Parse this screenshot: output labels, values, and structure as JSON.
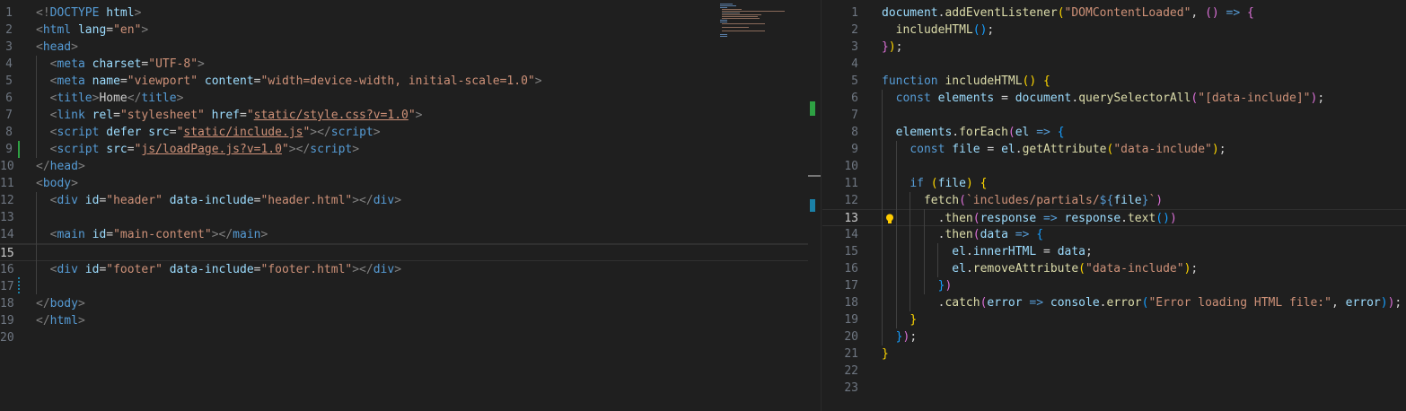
{
  "left_editor": {
    "lines": [
      {
        "n": "1",
        "tokens": [
          [
            "br",
            "<!"
          ],
          [
            "tag",
            "DOCTYPE"
          ],
          [
            "attr",
            " html"
          ],
          [
            "br",
            ">"
          ]
        ]
      },
      {
        "n": "2",
        "tokens": [
          [
            "br",
            "<"
          ],
          [
            "tag",
            "html"
          ],
          [
            "attr",
            " lang"
          ],
          [
            "txtc",
            "="
          ],
          [
            "str",
            "\"en\""
          ],
          [
            "br",
            ">"
          ]
        ]
      },
      {
        "n": "3",
        "tokens": [
          [
            "br",
            "<"
          ],
          [
            "tag",
            "head"
          ],
          [
            "br",
            ">"
          ]
        ]
      },
      {
        "n": "4",
        "tokens": [
          [
            "txtc",
            "  "
          ],
          [
            "br",
            "<"
          ],
          [
            "tag",
            "meta"
          ],
          [
            "attr",
            " charset"
          ],
          [
            "txtc",
            "="
          ],
          [
            "str",
            "\"UTF-8\""
          ],
          [
            "br",
            ">"
          ]
        ]
      },
      {
        "n": "5",
        "tokens": [
          [
            "txtc",
            "  "
          ],
          [
            "br",
            "<"
          ],
          [
            "tag",
            "meta"
          ],
          [
            "attr",
            " name"
          ],
          [
            "txtc",
            "="
          ],
          [
            "str",
            "\"viewport\""
          ],
          [
            "attr",
            " content"
          ],
          [
            "txtc",
            "="
          ],
          [
            "str",
            "\"width=device-width, initial-scale=1.0\""
          ],
          [
            "br",
            ">"
          ]
        ]
      },
      {
        "n": "6",
        "tokens": [
          [
            "txtc",
            "  "
          ],
          [
            "br",
            "<"
          ],
          [
            "tag",
            "title"
          ],
          [
            "br",
            ">"
          ],
          [
            "txtc",
            "Home"
          ],
          [
            "br",
            "</"
          ],
          [
            "tag",
            "title"
          ],
          [
            "br",
            ">"
          ]
        ]
      },
      {
        "n": "7",
        "tokens": [
          [
            "txtc",
            "  "
          ],
          [
            "br",
            "<"
          ],
          [
            "tag",
            "link"
          ],
          [
            "attr",
            " rel"
          ],
          [
            "txtc",
            "="
          ],
          [
            "str",
            "\"stylesheet\""
          ],
          [
            "attr",
            " href"
          ],
          [
            "txtc",
            "="
          ],
          [
            "str",
            "\""
          ],
          [
            "link",
            "static/style.css?v=1.0"
          ],
          [
            "str",
            "\""
          ],
          [
            "br",
            ">"
          ]
        ]
      },
      {
        "n": "8",
        "tokens": [
          [
            "txtc",
            "  "
          ],
          [
            "br",
            "<"
          ],
          [
            "tag",
            "script"
          ],
          [
            "attr",
            " defer src"
          ],
          [
            "txtc",
            "="
          ],
          [
            "str",
            "\""
          ],
          [
            "link",
            "static/include.js"
          ],
          [
            "str",
            "\""
          ],
          [
            "br",
            "></"
          ],
          [
            "tag",
            "script"
          ],
          [
            "br",
            ">"
          ]
        ]
      },
      {
        "n": "9",
        "tokens": [
          [
            "txtc",
            "  "
          ],
          [
            "br",
            "<"
          ],
          [
            "tag",
            "script"
          ],
          [
            "attr",
            " src"
          ],
          [
            "txtc",
            "="
          ],
          [
            "str",
            "\""
          ],
          [
            "link",
            "js/loadPage.js?v=1.0"
          ],
          [
            "str",
            "\""
          ],
          [
            "br",
            "></"
          ],
          [
            "tag",
            "script"
          ],
          [
            "br",
            ">"
          ]
        ]
      },
      {
        "n": "10",
        "tokens": [
          [
            "br",
            "</"
          ],
          [
            "tag",
            "head"
          ],
          [
            "br",
            ">"
          ]
        ]
      },
      {
        "n": "11",
        "tokens": [
          [
            "br",
            "<"
          ],
          [
            "tag",
            "body"
          ],
          [
            "br",
            ">"
          ]
        ]
      },
      {
        "n": "12",
        "tokens": [
          [
            "txtc",
            "  "
          ],
          [
            "br",
            "<"
          ],
          [
            "tag",
            "div"
          ],
          [
            "attr",
            " id"
          ],
          [
            "txtc",
            "="
          ],
          [
            "str",
            "\"header\""
          ],
          [
            "attr",
            " data-include"
          ],
          [
            "txtc",
            "="
          ],
          [
            "str",
            "\"header.html\""
          ],
          [
            "br",
            "></"
          ],
          [
            "tag",
            "div"
          ],
          [
            "br",
            ">"
          ]
        ]
      },
      {
        "n": "13",
        "tokens": []
      },
      {
        "n": "14",
        "tokens": [
          [
            "txtc",
            "  "
          ],
          [
            "br",
            "<"
          ],
          [
            "tag",
            "main"
          ],
          [
            "attr",
            " id"
          ],
          [
            "txtc",
            "="
          ],
          [
            "str",
            "\"main-content\""
          ],
          [
            "br",
            "></"
          ],
          [
            "tag",
            "main"
          ],
          [
            "br",
            ">"
          ]
        ]
      },
      {
        "n": "15",
        "tokens": []
      },
      {
        "n": "16",
        "tokens": [
          [
            "txtc",
            "  "
          ],
          [
            "br",
            "<"
          ],
          [
            "tag",
            "div"
          ],
          [
            "attr",
            " id"
          ],
          [
            "txtc",
            "="
          ],
          [
            "str",
            "\"footer\""
          ],
          [
            "attr",
            " data-include"
          ],
          [
            "txtc",
            "="
          ],
          [
            "str",
            "\"footer.html\""
          ],
          [
            "br",
            "></"
          ],
          [
            "tag",
            "div"
          ],
          [
            "br",
            ">"
          ]
        ]
      },
      {
        "n": "17",
        "tokens": []
      },
      {
        "n": "18",
        "tokens": [
          [
            "br",
            "</"
          ],
          [
            "tag",
            "body"
          ],
          [
            "br",
            ">"
          ]
        ]
      },
      {
        "n": "19",
        "tokens": [
          [
            "br",
            "</"
          ],
          [
            "tag",
            "html"
          ],
          [
            "br",
            ">"
          ]
        ]
      },
      {
        "n": "20",
        "tokens": []
      }
    ]
  },
  "right_editor": {
    "lines": [
      {
        "n": "1",
        "tokens": [
          [
            "var",
            "document"
          ],
          [
            "op",
            "."
          ],
          [
            "fn",
            "addEventListener"
          ],
          [
            "p1",
            "("
          ],
          [
            "str",
            "\"DOMContentLoaded\""
          ],
          [
            "op",
            ", "
          ],
          [
            "p2",
            "()"
          ],
          [
            "kw",
            " =>"
          ],
          [
            "op",
            " "
          ],
          [
            "p2",
            "{"
          ]
        ]
      },
      {
        "n": "2",
        "tokens": [
          [
            "op",
            "  "
          ],
          [
            "fn",
            "includeHTML"
          ],
          [
            "p3",
            "()"
          ],
          [
            "op",
            ";"
          ]
        ]
      },
      {
        "n": "3",
        "tokens": [
          [
            "p2",
            "}"
          ],
          [
            "p1",
            ")"
          ],
          [
            "op",
            ";"
          ]
        ]
      },
      {
        "n": "4",
        "tokens": []
      },
      {
        "n": "5",
        "tokens": [
          [
            "kw",
            "function"
          ],
          [
            "fn",
            " includeHTML"
          ],
          [
            "p1",
            "()"
          ],
          [
            "op",
            " "
          ],
          [
            "p1",
            "{"
          ]
        ]
      },
      {
        "n": "6",
        "tokens": [
          [
            "op",
            "  "
          ],
          [
            "kw",
            "const"
          ],
          [
            "var",
            " elements"
          ],
          [
            "op",
            " = "
          ],
          [
            "var",
            "document"
          ],
          [
            "op",
            "."
          ],
          [
            "fn",
            "querySelectorAll"
          ],
          [
            "p2",
            "("
          ],
          [
            "str",
            "\"[data-include]\""
          ],
          [
            "p2",
            ")"
          ],
          [
            "op",
            ";"
          ]
        ]
      },
      {
        "n": "7",
        "tokens": []
      },
      {
        "n": "8",
        "tokens": [
          [
            "op",
            "  "
          ],
          [
            "var",
            "elements"
          ],
          [
            "op",
            "."
          ],
          [
            "fn",
            "forEach"
          ],
          [
            "p2",
            "("
          ],
          [
            "var",
            "el"
          ],
          [
            "kw",
            " =>"
          ],
          [
            "op",
            " "
          ],
          [
            "p3",
            "{"
          ]
        ]
      },
      {
        "n": "9",
        "tokens": [
          [
            "op",
            "    "
          ],
          [
            "kw",
            "const"
          ],
          [
            "var",
            " file"
          ],
          [
            "op",
            " = "
          ],
          [
            "var",
            "el"
          ],
          [
            "op",
            "."
          ],
          [
            "fn",
            "getAttribute"
          ],
          [
            "p1",
            "("
          ],
          [
            "str",
            "\"data-include\""
          ],
          [
            "p1",
            ")"
          ],
          [
            "op",
            ";"
          ]
        ]
      },
      {
        "n": "10",
        "tokens": []
      },
      {
        "n": "11",
        "tokens": [
          [
            "op",
            "    "
          ],
          [
            "kw",
            "if"
          ],
          [
            "op",
            " "
          ],
          [
            "p1",
            "("
          ],
          [
            "var",
            "file"
          ],
          [
            "p1",
            ")"
          ],
          [
            "op",
            " "
          ],
          [
            "p1",
            "{"
          ]
        ]
      },
      {
        "n": "12",
        "tokens": [
          [
            "op",
            "      "
          ],
          [
            "fn",
            "fetch"
          ],
          [
            "p2",
            "("
          ],
          [
            "str",
            "`includes/partials/"
          ],
          [
            "tmpl",
            "${"
          ],
          [
            "var",
            "file"
          ],
          [
            "tmpl",
            "}"
          ],
          [
            "str",
            "`"
          ],
          [
            "p2",
            ")"
          ]
        ]
      },
      {
        "n": "13",
        "tokens": [
          [
            "op",
            "        ."
          ],
          [
            "fn",
            "then"
          ],
          [
            "p2",
            "("
          ],
          [
            "var",
            "response"
          ],
          [
            "kw",
            " =>"
          ],
          [
            "var",
            " response"
          ],
          [
            "op",
            "."
          ],
          [
            "fn",
            "text"
          ],
          [
            "p3",
            "()"
          ],
          [
            "p2",
            ")"
          ]
        ]
      },
      {
        "n": "14",
        "tokens": [
          [
            "op",
            "        ."
          ],
          [
            "fn",
            "then"
          ],
          [
            "p2",
            "("
          ],
          [
            "var",
            "data"
          ],
          [
            "kw",
            " =>"
          ],
          [
            "op",
            " "
          ],
          [
            "p3",
            "{"
          ]
        ]
      },
      {
        "n": "15",
        "tokens": [
          [
            "op",
            "          "
          ],
          [
            "var",
            "el"
          ],
          [
            "op",
            "."
          ],
          [
            "var",
            "innerHTML"
          ],
          [
            "op",
            " = "
          ],
          [
            "var",
            "data"
          ],
          [
            "op",
            ";"
          ]
        ]
      },
      {
        "n": "16",
        "tokens": [
          [
            "op",
            "          "
          ],
          [
            "var",
            "el"
          ],
          [
            "op",
            "."
          ],
          [
            "fn",
            "removeAttribute"
          ],
          [
            "p1",
            "("
          ],
          [
            "str",
            "\"data-include\""
          ],
          [
            "p1",
            ")"
          ],
          [
            "op",
            ";"
          ]
        ]
      },
      {
        "n": "17",
        "tokens": [
          [
            "op",
            "        "
          ],
          [
            "p3",
            "}"
          ],
          [
            "p2",
            ")"
          ]
        ]
      },
      {
        "n": "18",
        "tokens": [
          [
            "op",
            "        ."
          ],
          [
            "fn",
            "catch"
          ],
          [
            "p2",
            "("
          ],
          [
            "var",
            "error"
          ],
          [
            "kw",
            " =>"
          ],
          [
            "var",
            " console"
          ],
          [
            "op",
            "."
          ],
          [
            "fn",
            "error"
          ],
          [
            "p3",
            "("
          ],
          [
            "str",
            "\"Error loading HTML file:\""
          ],
          [
            "op",
            ", "
          ],
          [
            "var",
            "error"
          ],
          [
            "p3",
            ")"
          ],
          [
            "p2",
            ")"
          ],
          [
            "op",
            ";"
          ]
        ]
      },
      {
        "n": "19",
        "tokens": [
          [
            "op",
            "    "
          ],
          [
            "p1",
            "}"
          ]
        ]
      },
      {
        "n": "20",
        "tokens": [
          [
            "op",
            "  "
          ],
          [
            "p3",
            "}"
          ],
          [
            "p2",
            ")"
          ],
          [
            "op",
            ";"
          ]
        ]
      },
      {
        "n": "21",
        "tokens": [
          [
            "p1",
            "}"
          ]
        ]
      },
      {
        "n": "22",
        "tokens": []
      },
      {
        "n": "23",
        "tokens": []
      }
    ]
  }
}
